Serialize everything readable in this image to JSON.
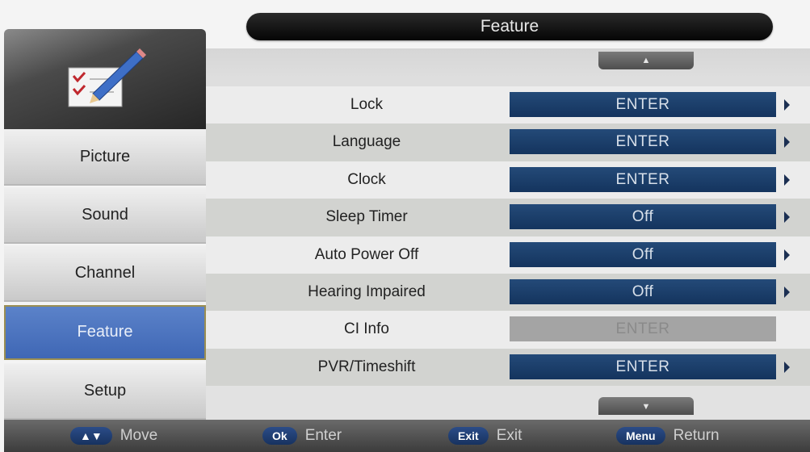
{
  "header": {
    "title": "Feature"
  },
  "main": {
    "scroll_up_glyph": "▲",
    "scroll_down_glyph": "▼",
    "rows": [
      {
        "label": "Lock",
        "value": "ENTER",
        "enabled": true
      },
      {
        "label": "Language",
        "value": "ENTER",
        "enabled": true
      },
      {
        "label": "Clock",
        "value": "ENTER",
        "enabled": true
      },
      {
        "label": "Sleep Timer",
        "value": "Off",
        "enabled": true
      },
      {
        "label": "Auto Power Off",
        "value": "Off",
        "enabled": true
      },
      {
        "label": "Hearing Impaired",
        "value": "Off",
        "enabled": true
      },
      {
        "label": "CI Info",
        "value": "ENTER",
        "enabled": false
      },
      {
        "label": "PVR/Timeshift",
        "value": "ENTER",
        "enabled": true
      }
    ]
  },
  "sidebar": {
    "icon": "checklist-pencil-icon",
    "items": [
      {
        "label": "Picture"
      },
      {
        "label": "Sound"
      },
      {
        "label": "Channel"
      },
      {
        "label": "Feature",
        "active": true
      },
      {
        "label": "Setup"
      }
    ]
  },
  "footer": {
    "items": [
      {
        "key": "▲▼",
        "text": "Move"
      },
      {
        "key": "Ok",
        "text": "Enter"
      },
      {
        "key": "Exit",
        "text": "Exit"
      },
      {
        "key": "Menu",
        "text": "Return"
      }
    ]
  },
  "colors": {
    "value_bg": "#1d4170",
    "active_tab": "#4a72bf",
    "title_bar": "#111111"
  }
}
